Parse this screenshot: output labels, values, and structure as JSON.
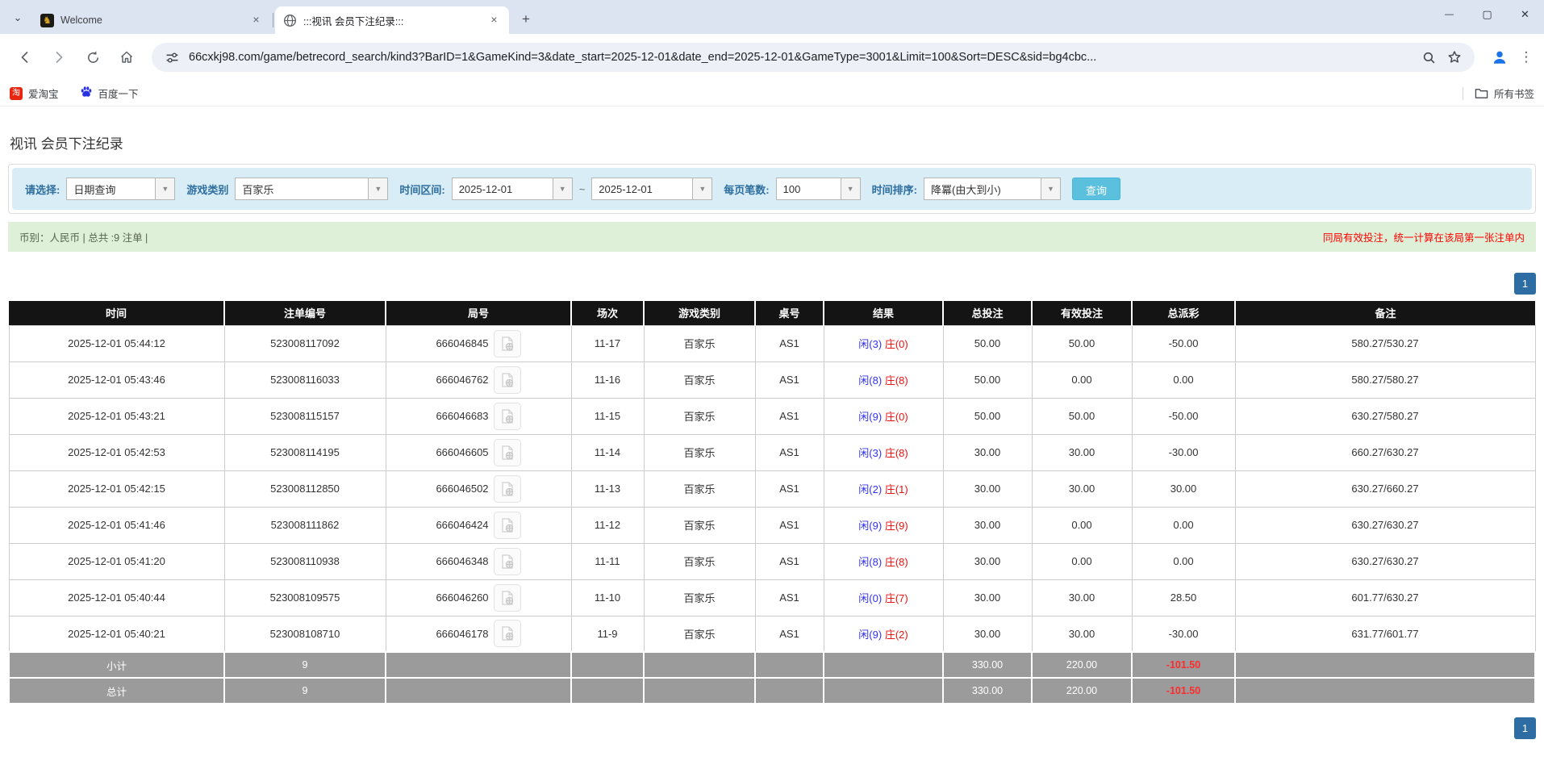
{
  "colors": {
    "player_blue": "#3333ee",
    "banker_red": "#ee1111",
    "link_blue": "#1a66d9",
    "negative_red": "#ff0000",
    "header_bg": "#141414",
    "footer_bg": "#9b9b9b",
    "filter_bg": "#d9edf7",
    "summary_bg": "#dff0d8",
    "label_blue": "#2e6e9e",
    "button_blue": "#5bc0de",
    "pagination_blue": "#2e6da4"
  },
  "icons": {
    "tab_list_chevron": "⌄",
    "new_tab": "+",
    "minimize": "—",
    "maximize": "▢",
    "close_window": "✕",
    "tab_close": "×",
    "combo_arrow": "▼",
    "menu_dots": "⋮"
  },
  "browser": {
    "tabs": [
      {
        "title": "Welcome"
      },
      {
        "title": ":::视讯 会员下注纪录:::"
      }
    ],
    "url": "66cxkj98.com/game/betrecord_search/kind3?BarID=1&GameKind=3&date_start=2025-12-01&date_end=2025-12-01&GameType=3001&Limit=100&Sort=DESC&sid=bg4cbc...",
    "bookmarks": [
      {
        "label": "爱淘宝",
        "icon_text": "淘"
      },
      {
        "label": "百度一下"
      }
    ],
    "all_bookmarks_label": "所有书签"
  },
  "page": {
    "title": "视讯 会员下注纪录",
    "filters": {
      "select_label": "请选择:",
      "select_value": "日期查询",
      "game_type_label": "游戏类别",
      "game_type_value": "百家乐",
      "date_range_label": "时间区间:",
      "date_from": "2025-12-01",
      "tilde": "~",
      "date_to": "2025-12-01",
      "per_page_label": "每页笔数:",
      "per_page_value": "100",
      "sort_label": "时间排序:",
      "sort_value": "降冪(由大到小)",
      "search_button": "查询"
    },
    "summary": {
      "left": "币别：人民币 | 总共 :9 注单 |",
      "right": "同局有效投注，统一计算在该局第一张注单内"
    },
    "pagination": "1",
    "table": {
      "headers": [
        "时间",
        "注单编号",
        "局号",
        "场次",
        "游戏类别",
        "桌号",
        "结果",
        "总投注",
        "有效投注",
        "总派彩",
        "备注"
      ],
      "rows": [
        {
          "time": "2025-12-01 05:44:12",
          "bet_id": "523008117092",
          "round_id": "666046845",
          "session": "11-17",
          "game": "百家乐",
          "table": "AS1",
          "result_player": "闲(3)",
          "result_banker": "庄(0)",
          "total_bet": "50.00",
          "valid_bet": "50.00",
          "payout": "-50.00",
          "note": "580.27/530.27"
        },
        {
          "time": "2025-12-01 05:43:46",
          "bet_id": "523008116033",
          "round_id": "666046762",
          "session": "11-16",
          "game": "百家乐",
          "table": "AS1",
          "result_player": "闲(8)",
          "result_banker": "庄(8)",
          "total_bet": "50.00",
          "valid_bet": "0.00",
          "payout": "0.00",
          "note": "580.27/580.27"
        },
        {
          "time": "2025-12-01 05:43:21",
          "bet_id": "523008115157",
          "round_id": "666046683",
          "session": "11-15",
          "game": "百家乐",
          "table": "AS1",
          "result_player": "闲(9)",
          "result_banker": "庄(0)",
          "total_bet": "50.00",
          "valid_bet": "50.00",
          "payout": "-50.00",
          "note": "630.27/580.27"
        },
        {
          "time": "2025-12-01 05:42:53",
          "bet_id": "523008114195",
          "round_id": "666046605",
          "session": "11-14",
          "game": "百家乐",
          "table": "AS1",
          "result_player": "闲(3)",
          "result_banker": "庄(8)",
          "total_bet": "30.00",
          "valid_bet": "30.00",
          "payout": "-30.00",
          "note": "660.27/630.27"
        },
        {
          "time": "2025-12-01 05:42:15",
          "bet_id": "523008112850",
          "round_id": "666046502",
          "session": "11-13",
          "game": "百家乐",
          "table": "AS1",
          "result_player": "闲(2)",
          "result_banker": "庄(1)",
          "total_bet": "30.00",
          "valid_bet": "30.00",
          "payout": "30.00",
          "note": "630.27/660.27"
        },
        {
          "time": "2025-12-01 05:41:46",
          "bet_id": "523008111862",
          "round_id": "666046424",
          "session": "11-12",
          "game": "百家乐",
          "table": "AS1",
          "result_player": "闲(9)",
          "result_banker": "庄(9)",
          "total_bet": "30.00",
          "valid_bet": "0.00",
          "payout": "0.00",
          "note": "630.27/630.27"
        },
        {
          "time": "2025-12-01 05:41:20",
          "bet_id": "523008110938",
          "round_id": "666046348",
          "session": "11-11",
          "game": "百家乐",
          "table": "AS1",
          "result_player": "闲(8)",
          "result_banker": "庄(8)",
          "total_bet": "30.00",
          "valid_bet": "0.00",
          "payout": "0.00",
          "note": "630.27/630.27"
        },
        {
          "time": "2025-12-01 05:40:44",
          "bet_id": "523008109575",
          "round_id": "666046260",
          "session": "11-10",
          "game": "百家乐",
          "table": "AS1",
          "result_player": "闲(0)",
          "result_banker": "庄(7)",
          "total_bet": "30.00",
          "valid_bet": "30.00",
          "payout": "28.50",
          "note": "601.77/630.27"
        },
        {
          "time": "2025-12-01 05:40:21",
          "bet_id": "523008108710",
          "round_id": "666046178",
          "session": "11-9",
          "game": "百家乐",
          "table": "AS1",
          "result_player": "闲(9)",
          "result_banker": "庄(2)",
          "total_bet": "30.00",
          "valid_bet": "30.00",
          "payout": "-30.00",
          "note": "631.77/601.77"
        }
      ],
      "footer": [
        {
          "label": "小计",
          "count": "9",
          "total_bet": "330.00",
          "valid_bet": "220.00",
          "payout": "-101.50"
        },
        {
          "label": "总计",
          "count": "9",
          "total_bet": "330.00",
          "valid_bet": "220.00",
          "payout": "-101.50"
        }
      ]
    }
  }
}
